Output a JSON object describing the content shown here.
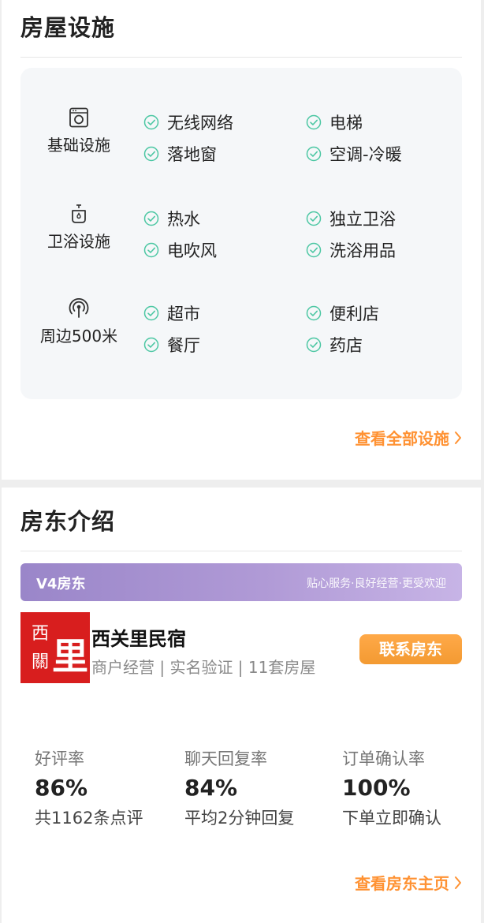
{
  "facilities": {
    "title": "房屋设施",
    "groups": [
      {
        "category": "基础设施",
        "icon": "washing-machine-icon",
        "items": [
          "无线网络",
          "电梯",
          "落地窗",
          "空调-冷暖"
        ]
      },
      {
        "category": "卫浴设施",
        "icon": "shower-bath-icon",
        "items": [
          "热水",
          "独立卫浴",
          "电吹风",
          "洗浴用品"
        ]
      },
      {
        "category": "周边500米",
        "icon": "location-radar-icon",
        "items": [
          "超市",
          "便利店",
          "餐厅",
          "药店"
        ]
      }
    ],
    "view_all": "查看全部设施"
  },
  "host": {
    "title": "房东介绍",
    "level": "V4房东",
    "level_tagline": "贴心服务·良好经营·更受欢迎",
    "logo_text": "西關里",
    "name": "西关里民宿",
    "meta": "商户经营 | 实名验证 | 11套房屋",
    "contact_label": "联系房东",
    "stats": [
      {
        "label": "好评率",
        "value": "86%",
        "sub": "共1162条点评"
      },
      {
        "label": "聊天回复率",
        "value": "84%",
        "sub": "平均2分钟回复"
      },
      {
        "label": "订单确认率",
        "value": "100%",
        "sub": "下单立即确认"
      }
    ],
    "view_home": "查看房东主页"
  },
  "colors": {
    "accent_orange": "#ff9233",
    "check_green": "#4cc7a3",
    "v4_purple": "#a993d4",
    "logo_red": "#d81e1e"
  }
}
